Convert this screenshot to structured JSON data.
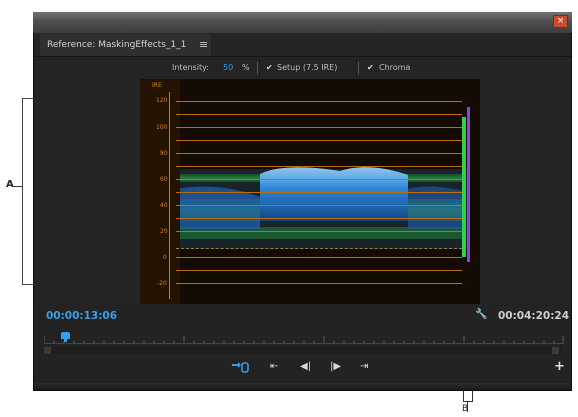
{
  "callouts": {
    "a": "A",
    "b": "B"
  },
  "window": {
    "close_glyph": "×"
  },
  "tab": {
    "title": "Reference: MaskingEffects_1_1",
    "menu_glyph": "≡"
  },
  "settings": {
    "intensity_label": "Intensity:",
    "intensity_value": "50",
    "intensity_unit": "%",
    "setup_label": "Setup (7.5 IRE)",
    "setup_checked": true,
    "chroma_label": "Chroma",
    "chroma_checked": true,
    "check_glyph": "✔"
  },
  "scope": {
    "ire_title": "IRE",
    "ire_ticks": [
      "120",
      "100",
      "80",
      "60",
      "40",
      "20",
      "0",
      "-20"
    ],
    "trace_colors": {
      "luma": "#2f9bff",
      "chroma": "#1fb53a",
      "grid": "#b86e13"
    },
    "intensity_bar_color": "#8a45d8"
  },
  "controls": {
    "timecode_current": "00:00:13:06",
    "timecode_duration": "00:04:20:24",
    "buttons": {
      "mark_in": "⇤",
      "step_back": "◀|",
      "step_forward": "|▶",
      "mark_out": "⇥",
      "add": "+"
    },
    "icons": [
      "wrench-icon",
      "loop-icon",
      "mark-in-icon",
      "step-back-icon",
      "step-forward-icon",
      "mark-out-icon",
      "add-icon"
    ]
  }
}
